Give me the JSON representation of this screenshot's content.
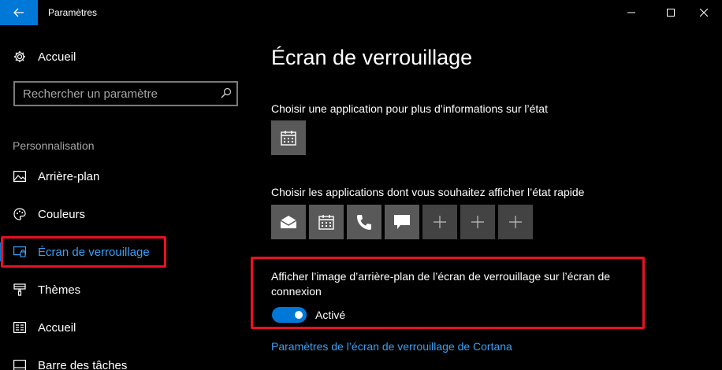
{
  "window": {
    "title": "Paramètres"
  },
  "sidebar": {
    "home_label": "Accueil",
    "search_placeholder": "Rechercher un paramètre",
    "section_header": "Personnalisation",
    "items": [
      {
        "label": "Arrière-plan",
        "icon": "picture-icon"
      },
      {
        "label": "Couleurs",
        "icon": "palette-icon"
      },
      {
        "label": "Écran de verrouillage",
        "icon": "lock-screen-icon",
        "active": true
      },
      {
        "label": "Thèmes",
        "icon": "brush-icon"
      },
      {
        "label": "Accueil",
        "icon": "start-icon"
      },
      {
        "label": "Barre des tâches",
        "icon": "taskbar-icon"
      }
    ]
  },
  "main": {
    "title": "Écran de verrouillage",
    "detailed_status_label": "Choisir une application pour plus d’informations sur l’état",
    "quick_status_label": "Choisir les applications dont vous souhaitez afficher l’état rapide",
    "quick_tiles": [
      {
        "icon": "mail-icon"
      },
      {
        "icon": "calendar-icon"
      },
      {
        "icon": "phone-icon"
      },
      {
        "icon": "message-icon"
      },
      {
        "icon": "plus-icon"
      },
      {
        "icon": "plus-icon"
      },
      {
        "icon": "plus-icon"
      }
    ],
    "signin_bg_label": "Afficher l’image d’arrière-plan de l’écran de verrouillage sur l’écran de connexion",
    "toggle_state": "Activé",
    "toggle_on": true,
    "cortana_link": "Paramètres de l’écran de verrouillage de Cortana"
  },
  "colors": {
    "accent": "#0078d7",
    "link": "#3aa0f5",
    "highlight": "#e81123",
    "tile": "#595959",
    "tile_empty": "#434343"
  }
}
